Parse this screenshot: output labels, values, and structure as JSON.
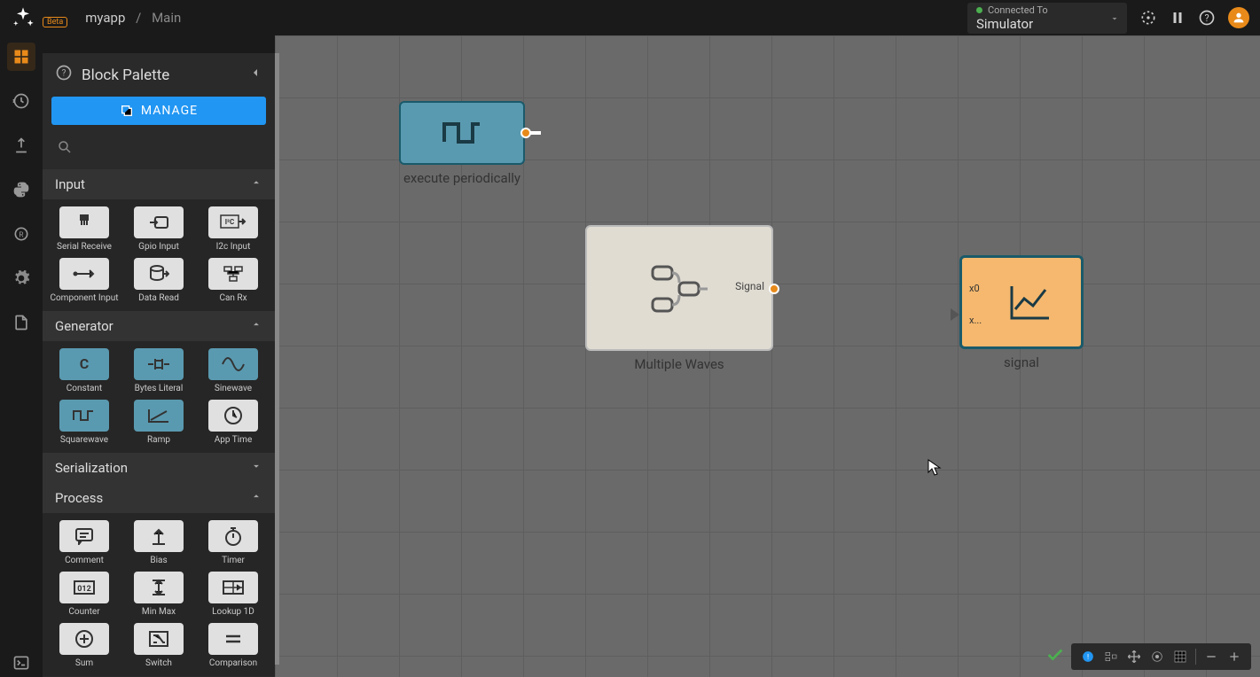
{
  "header": {
    "app": "myapp",
    "separator": "/",
    "current": "Main",
    "beta": "Beta",
    "connection": {
      "label": "Connected To",
      "value": "Simulator"
    }
  },
  "palette": {
    "title": "Block Palette",
    "manage": "MANAGE",
    "categories": [
      {
        "name": "Input",
        "open": true,
        "items": [
          {
            "label": "Serial Receive",
            "style": "dark"
          },
          {
            "label": "Gpio Input",
            "style": "dark"
          },
          {
            "label": "I2c Input",
            "style": "dark"
          },
          {
            "label": "Component Input",
            "style": "dark"
          },
          {
            "label": "Data Read",
            "style": "dark"
          },
          {
            "label": "Can Rx",
            "style": "dark"
          }
        ]
      },
      {
        "name": "Generator",
        "open": true,
        "items": [
          {
            "label": "Constant",
            "style": "blue",
            "glyph": "C"
          },
          {
            "label": "Bytes Literal",
            "style": "blue"
          },
          {
            "label": "Sinewave",
            "style": "blue"
          },
          {
            "label": "Squarewave",
            "style": "blue"
          },
          {
            "label": "Ramp",
            "style": "blue"
          },
          {
            "label": "App Time",
            "style": "dark"
          }
        ]
      },
      {
        "name": "Serialization",
        "open": false,
        "items": []
      },
      {
        "name": "Process",
        "open": true,
        "items": [
          {
            "label": "Comment",
            "style": "dark"
          },
          {
            "label": "Bias",
            "style": "dark"
          },
          {
            "label": "Timer",
            "style": "dark"
          },
          {
            "label": "Counter",
            "style": "dark"
          },
          {
            "label": "Min Max",
            "style": "dark"
          },
          {
            "label": "Lookup 1D",
            "style": "dark"
          },
          {
            "label": "Sum",
            "style": "dark"
          },
          {
            "label": "Switch",
            "style": "dark"
          },
          {
            "label": "Comparison",
            "style": "dark"
          }
        ]
      }
    ]
  },
  "canvas": {
    "nodes": {
      "exec": {
        "label": "execute periodically"
      },
      "mw": {
        "label": "Multiple Waves",
        "port_label": "Signal"
      },
      "sig": {
        "label": "signal",
        "in0": "x0",
        "in1": "x..."
      }
    }
  }
}
